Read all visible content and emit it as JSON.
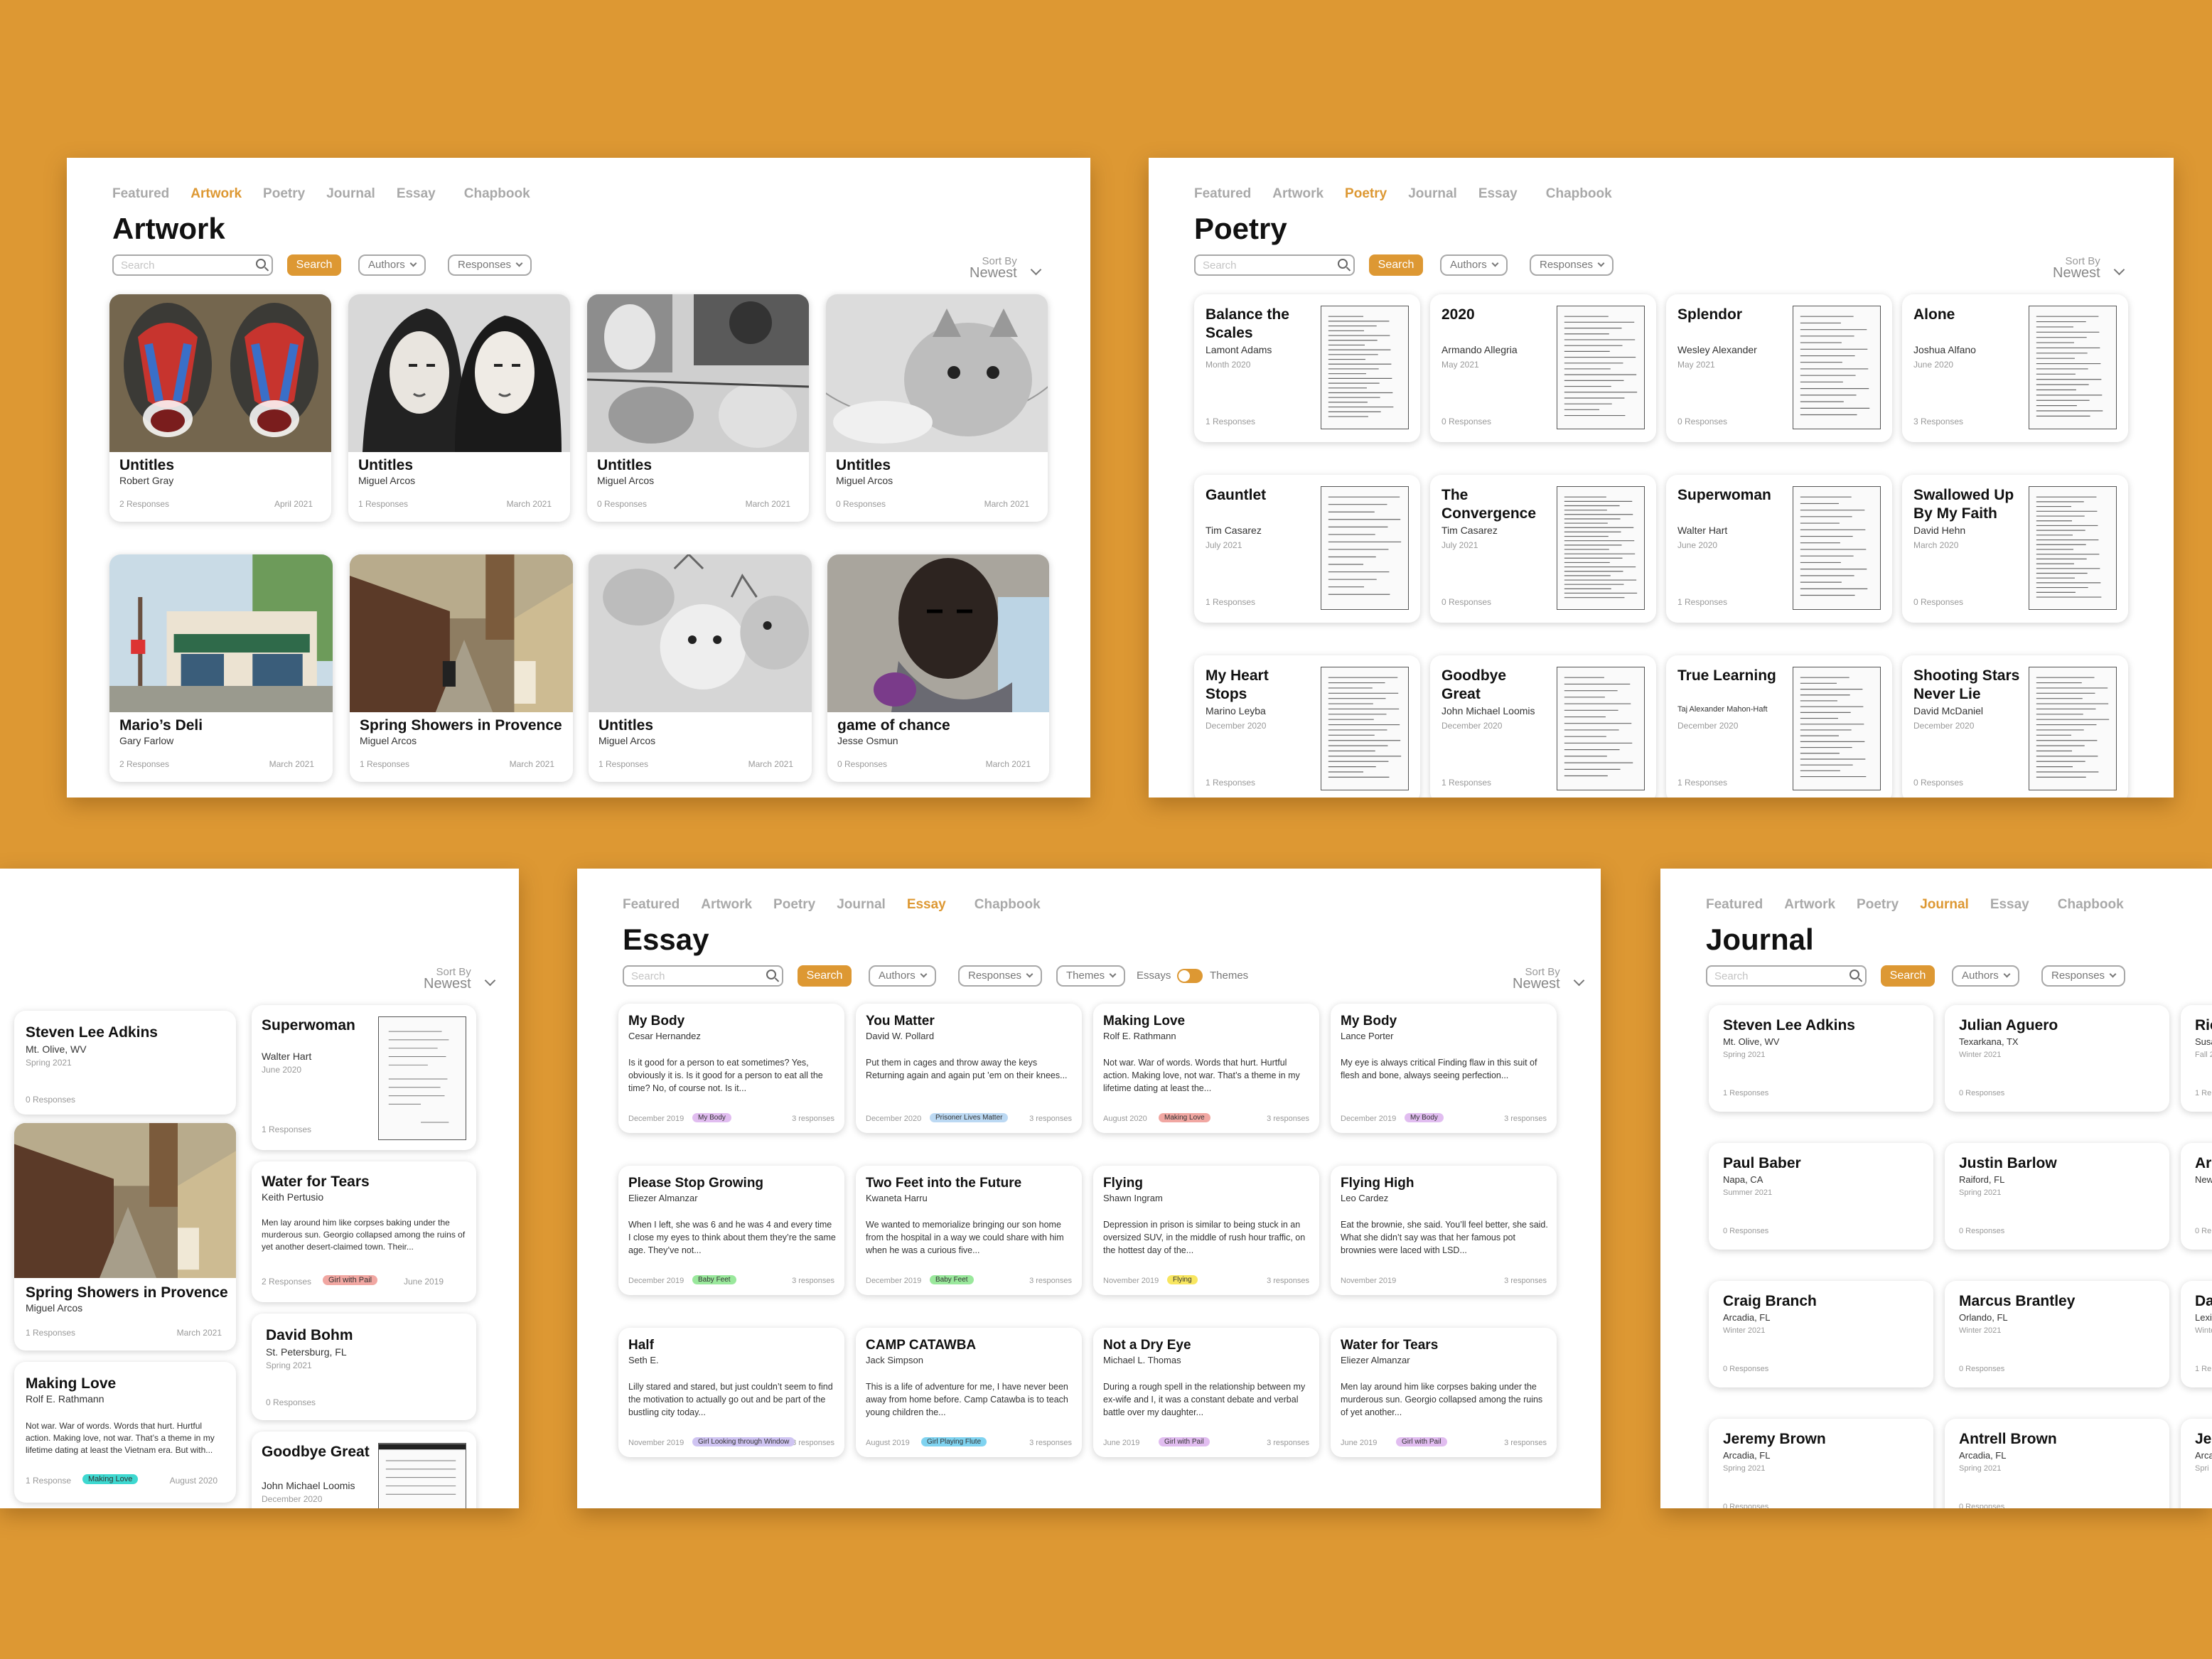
{
  "nav": [
    "Featured",
    "Artwork",
    "Poetry",
    "Journal",
    "Essay",
    "Chapbook"
  ],
  "ui": {
    "search_placeholder": "Search",
    "search_button": "Search",
    "authors": "Authors",
    "responses": "Responses",
    "themes": "Themes",
    "sort_by": "Sort By",
    "sort_value": "Newest",
    "toggle_left": "Essays",
    "toggle_right": "Themes"
  },
  "colors": {
    "background": "#dd9833",
    "accent": "#dd9833",
    "tag_pink": "#f1a7a2",
    "tag_blue": "#bcd9f3",
    "tag_green": "#9ae89c",
    "tag_yellow": "#f8e660",
    "tag_purple": "#e1bdf0",
    "tag_lavender": "#cfc4f2",
    "tag_teal": "#3ed8d0"
  },
  "artwork": {
    "title": "Artwork",
    "cards": [
      {
        "title": "Untitles",
        "author": "Robert Gray",
        "responses": "2 Responses",
        "date": "April 2021"
      },
      {
        "title": "Untitles",
        "author": "Miguel Arcos",
        "responses": "1 Responses",
        "date": "March 2021"
      },
      {
        "title": "Untitles",
        "author": "Miguel Arcos",
        "responses": "0 Responses",
        "date": "March 2021"
      },
      {
        "title": "Untitles",
        "author": "Miguel Arcos",
        "responses": "0 Responses",
        "date": "March 2021"
      },
      {
        "title": "Mario’s Deli",
        "author": "Gary Farlow",
        "responses": "2 Responses",
        "date": "March 2021"
      },
      {
        "title": "Spring Showers in Provence",
        "author": "Miguel Arcos",
        "responses": "1 Responses",
        "date": "March 2021"
      },
      {
        "title": "Untitles",
        "author": "Miguel Arcos",
        "responses": "1 Responses",
        "date": "March 2021"
      },
      {
        "title": "game of chance",
        "author": "Jesse Osmun",
        "responses": "0 Responses",
        "date": "March 2021"
      }
    ]
  },
  "poetry": {
    "title": "Poetry",
    "cards": [
      {
        "title": "Balance the Scales",
        "author": "Lamont Adams",
        "date": "Month 2020",
        "responses": "1 Responses"
      },
      {
        "title": "2020",
        "author": "Armando Allegria",
        "date": "May 2021",
        "responses": "0 Responses"
      },
      {
        "title": "Splendor",
        "author": "Wesley Alexander",
        "date": "May 2021",
        "responses": "0 Responses"
      },
      {
        "title": "Alone",
        "author": "Joshua Alfano",
        "date": "June 2020",
        "responses": "3 Responses"
      },
      {
        "title": "Gauntlet",
        "author": "Tim Casarez",
        "date": "July 2021",
        "responses": "1 Responses"
      },
      {
        "title": "The Convergence",
        "author": "Tim Casarez",
        "date": "July 2021",
        "responses": "0 Responses"
      },
      {
        "title": "Superwoman",
        "author": "Walter Hart",
        "date": "June 2020",
        "responses": "1 Responses"
      },
      {
        "title": "Swallowed Up By My Faith",
        "author": "David Hehn",
        "date": "March 2020",
        "responses": "0 Responses"
      },
      {
        "title": "My Heart Stops",
        "author": "Marino Leyba",
        "date": "December 2020",
        "responses": "1 Responses"
      },
      {
        "title": "Goodbye Great",
        "author": "John Michael Loomis",
        "date": "December 2020",
        "responses": "1 Responses"
      },
      {
        "title": "True Learning",
        "author": "Taj Alexander Mahon-Haft",
        "date": "December 2020",
        "responses": "1 Responses"
      },
      {
        "title": "Shooting Stars Never Lie",
        "author": "David McDaniel",
        "date": "December 2020",
        "responses": "0 Responses"
      }
    ]
  },
  "featured": {
    "col1": [
      {
        "title": "Steven Lee Adkins",
        "location": "Mt. Olive, WV",
        "season": "Spring 2021",
        "responses": "0 Responses"
      },
      {
        "title": "Spring Showers in Provence",
        "author": "Miguel Arcos",
        "responses": "1 Responses",
        "date": "March 2021"
      },
      {
        "title": "Making Love",
        "author": "Rolf E. Rathmann",
        "excerpt": "Not war. War of words. Words that hurt. Hurtful action. Making love, not war. That’s a theme in my lifetime dating at least the Vietnam era. But with...",
        "responses": "1 Response",
        "tag": "Making Love",
        "date": "August 2020"
      }
    ],
    "col2": [
      {
        "title": "Superwoman",
        "author": "Walter Hart",
        "date": "June 2020",
        "responses": "1 Responses"
      },
      {
        "title": "Water for Tears",
        "author": "Keith Pertusio",
        "excerpt": "Men lay around him like corpses baking under the murderous sun. Georgio collapsed among the ruins of yet another desert-claimed town. Their...",
        "responses": "2 Responses",
        "tag": "Girl with Pail",
        "date": "June 2019"
      },
      {
        "title": "David Bohm",
        "location": "St. Petersburg, FL",
        "season": "Spring 2021",
        "responses": "0 Responses"
      },
      {
        "title": "Goodbye Great",
        "author": "John Michael Loomis",
        "date": "December 2020"
      }
    ]
  },
  "essay": {
    "title": "Essay",
    "cards": [
      {
        "title": "My Body",
        "author": "Cesar Hernandez",
        "excerpt": "Is it good for a person to eat sometimes? Yes, obviously it is. Is it good for a person to eat all the time? No, of course not. Is it...",
        "date": "December 2019",
        "tag": "My Body",
        "responses": "3 responses"
      },
      {
        "title": "You Matter",
        "author": "David W. Pollard",
        "excerpt": "Put them in cages and throw away the keys Returning again and again put ’em on their knees...",
        "date": "December 2020",
        "tag": "Prisoner Lives Matter",
        "responses": "3 responses"
      },
      {
        "title": "Making Love",
        "author": "Rolf E. Rathmann",
        "excerpt": "Not war. War of words. Words that hurt. Hurtful action. Making love, not war. That’s a theme in my lifetime dating at least the...",
        "date": "August 2020",
        "tag": "Making Love",
        "responses": "3 responses"
      },
      {
        "title": "My Body",
        "author": "Lance Porter",
        "excerpt": "My eye is always critical Finding flaw in this suit of flesh and bone, always seeing perfection...",
        "date": "December 2019",
        "tag": "My Body",
        "responses": "3 responses"
      },
      {
        "title": "Please Stop Growing",
        "author": "Eliezer Almanzar",
        "excerpt": "When I left, she was 6 and he was 4 and every time I close my eyes to think about them they’re the same age. They’ve not...",
        "date": "December 2019",
        "tag": "Baby Feet",
        "responses": "3 responses"
      },
      {
        "title": "Two Feet into the Future",
        "author": "Kwaneta Harru",
        "excerpt": "We wanted to memorialize bringing our son home from the hospital in a way we could share with him when he was a curious five...",
        "date": "December 2019",
        "tag": "Baby Feet",
        "responses": "3 responses"
      },
      {
        "title": "Flying",
        "author": "Shawn Ingram",
        "excerpt": "Depression in prison is similar to being stuck in an oversized SUV, in the middle of rush hour traffic, on the hottest day of the...",
        "date": "November 2019",
        "tag": "Flying",
        "responses": "3 responses"
      },
      {
        "title": "Flying High",
        "author": "Leo Cardez",
        "excerpt": "Eat the brownie, she said. You’ll feel better, she said. What she didn’t say was that her famous pot brownies were laced with LSD...",
        "date": "November 2019",
        "tag": "",
        "responses": "3 responses"
      },
      {
        "title": "Half",
        "author": "Seth E.",
        "excerpt": "Lilly stared and stared, but just couldn’t seem to find the motivation to actually go out and be part of the bustling city today...",
        "date": "November 2019",
        "tag": "Girl Looking through Window",
        "responses": "3 responses"
      },
      {
        "title": "CAMP CATAWBA",
        "author": "Jack Simpson",
        "excerpt": "This is a life of adventure for me, I have never been away from home before. Camp Catawba is to teach young children the...",
        "date": "August 2019",
        "tag": "Girl Playing Flute",
        "responses": "3 responses"
      },
      {
        "title": "Not a Dry Eye",
        "author": "Michael L. Thomas",
        "excerpt": "During a rough spell in the relationship between my ex-wife and I, it was a constant debate and verbal battle over my daughter...",
        "date": "June 2019",
        "tag": "Girl with Pail",
        "responses": "3 responses"
      },
      {
        "title": "Water for Tears",
        "author": "Eliezer Almanzar",
        "excerpt": "Men lay around him like corpses baking under the murderous sun. Georgio collapsed among the ruins of yet another...",
        "date": "June 2019",
        "tag": "Girl with Pail",
        "responses": "3 responses"
      }
    ]
  },
  "journal": {
    "title": "Journal",
    "cards": [
      {
        "name": "Steven Lee Adkins",
        "location": "Mt. Olive, WV",
        "season": "Spring 2021",
        "responses": "1 Responses"
      },
      {
        "name": "Julian Aguero",
        "location": "Texarkana, TX",
        "season": "Winter 2021",
        "responses": "0 Responses"
      },
      {
        "name": "Ric",
        "location": "Susa",
        "season": "Fall 2",
        "responses": "1 Re"
      },
      {
        "name": "Paul Baber",
        "location": "Napa, CA",
        "season": "Summer 2021",
        "responses": "0 Responses"
      },
      {
        "name": "Justin Barlow",
        "location": "Raiford, FL",
        "season": "Spring 2021",
        "responses": "0 Responses"
      },
      {
        "name": "Are",
        "location": "New",
        "season": "",
        "responses": "0 Re"
      },
      {
        "name": "Craig Branch",
        "location": "Arcadia, FL",
        "season": "Winter 2021",
        "responses": "0 Responses"
      },
      {
        "name": "Marcus Brantley",
        "location": "Orlando, FL",
        "season": "Winter 2021",
        "responses": "0 Responses"
      },
      {
        "name": "Da",
        "location": "Lexin",
        "season": "Winte",
        "responses": "1 Re"
      },
      {
        "name": "Jeremy Brown",
        "location": "Arcadia, FL",
        "season": "Spring 2021",
        "responses": "0 Responses"
      },
      {
        "name": "Antrell Brown",
        "location": "Arcadia, FL",
        "season": "Spring 2021",
        "responses": "0 Responses"
      },
      {
        "name": "Jer",
        "location": "Arca",
        "season": "Spri",
        "responses": ""
      }
    ]
  }
}
